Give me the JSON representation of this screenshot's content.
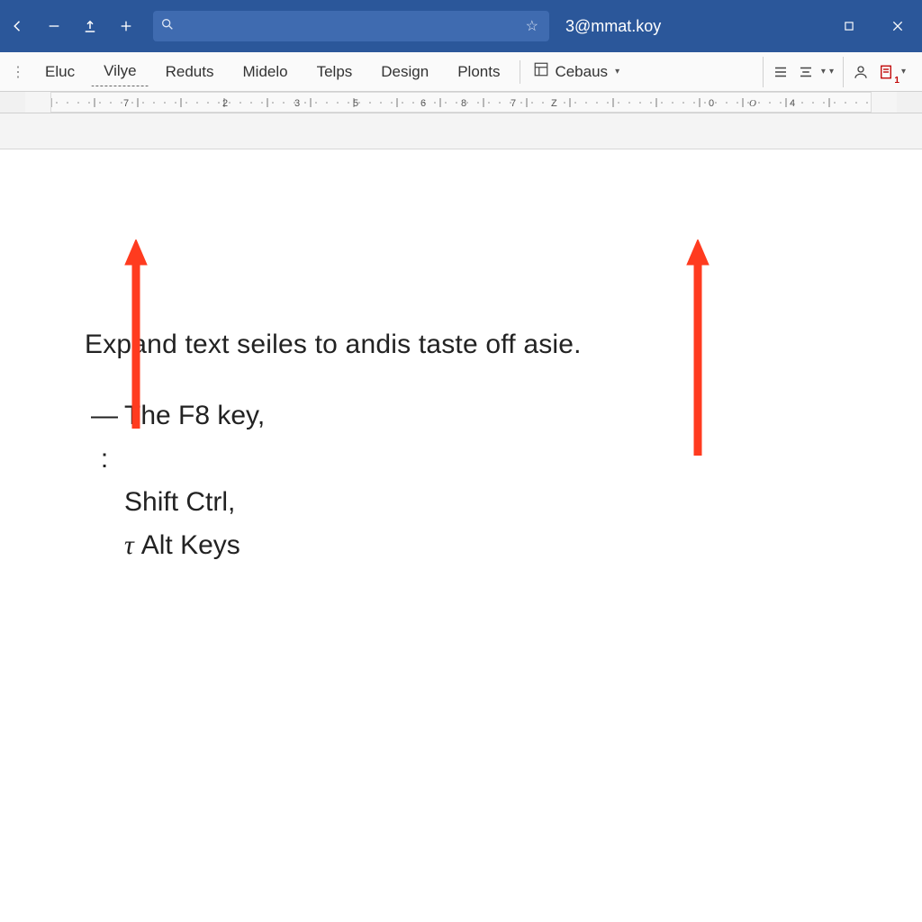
{
  "titlebar": {
    "search_placeholder": "",
    "account_label": "3@mmat.koy"
  },
  "menu": {
    "items": [
      "Eluc",
      "Vilye",
      "Reduts",
      "Midelo",
      "Telps",
      "Design",
      "Plonts"
    ],
    "cebaus_label": "Cebaus"
  },
  "ruler": {
    "labels": [
      "7",
      "2",
      "3",
      "5",
      "6",
      "8",
      "7",
      "Z",
      "0",
      "O",
      "4"
    ],
    "positions": [
      80,
      190,
      270,
      335,
      410,
      455,
      510,
      555,
      730,
      775,
      820,
      965
    ]
  },
  "ribbon_right": {
    "badge": "1"
  },
  "document": {
    "para1": "Expand text seiles to andis taste off asie.",
    "list": [
      {
        "bullet": "— :",
        "text": "The F8 key,"
      },
      {
        "bullet": "",
        "text": "Shift Ctrl,"
      },
      {
        "bullet": "τ",
        "text": "Alt Keys"
      }
    ]
  },
  "annotations": {
    "arrow_left": true,
    "arrow_right": true
  }
}
